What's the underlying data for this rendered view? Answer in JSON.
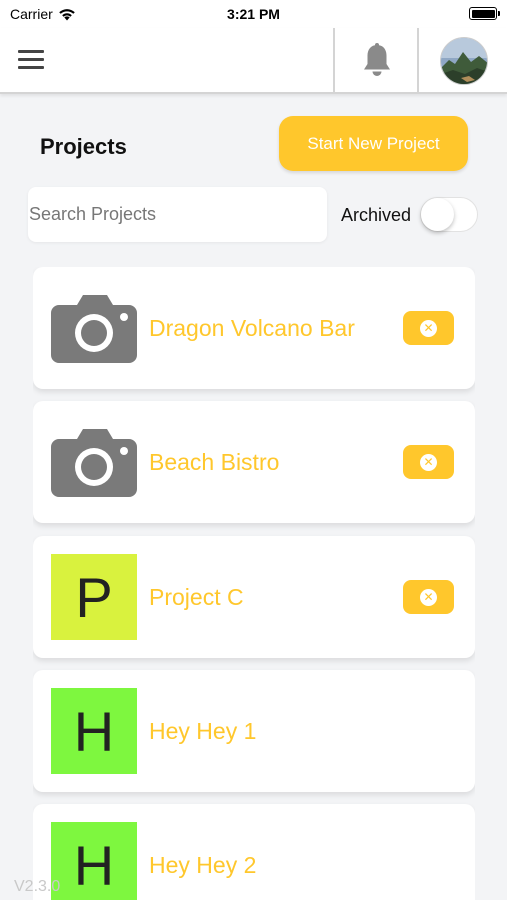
{
  "status_bar": {
    "carrier": "Carrier",
    "time": "3:21 PM"
  },
  "nav": {
    "menu_icon": "hamburger-menu-icon",
    "notification_icon": "bell-icon",
    "avatar_icon": "user-avatar"
  },
  "header": {
    "title": "Projects",
    "start_button_label": "Start New Project"
  },
  "search": {
    "placeholder": "Search Projects",
    "value": ""
  },
  "archived": {
    "label": "Archived",
    "enabled": false
  },
  "projects": [
    {
      "name": "Dragon Volcano Bar",
      "thumb_type": "camera",
      "deletable": true
    },
    {
      "name": "Beach Bistro",
      "thumb_type": "camera",
      "deletable": true
    },
    {
      "name": "Project C",
      "thumb_type": "letter",
      "letter": "P",
      "thumb_color": "#d9f23e",
      "deletable": true
    },
    {
      "name": "Hey Hey 1",
      "thumb_type": "letter",
      "letter": "H",
      "thumb_color": "#7ef73f",
      "deletable": false
    },
    {
      "name": "Hey Hey 2",
      "thumb_type": "letter",
      "letter": "H",
      "thumb_color": "#7ef73f",
      "deletable": false
    }
  ],
  "version": "V2.3.0",
  "colors": {
    "accent": "#ffc72c",
    "background": "#f3f4f6"
  }
}
